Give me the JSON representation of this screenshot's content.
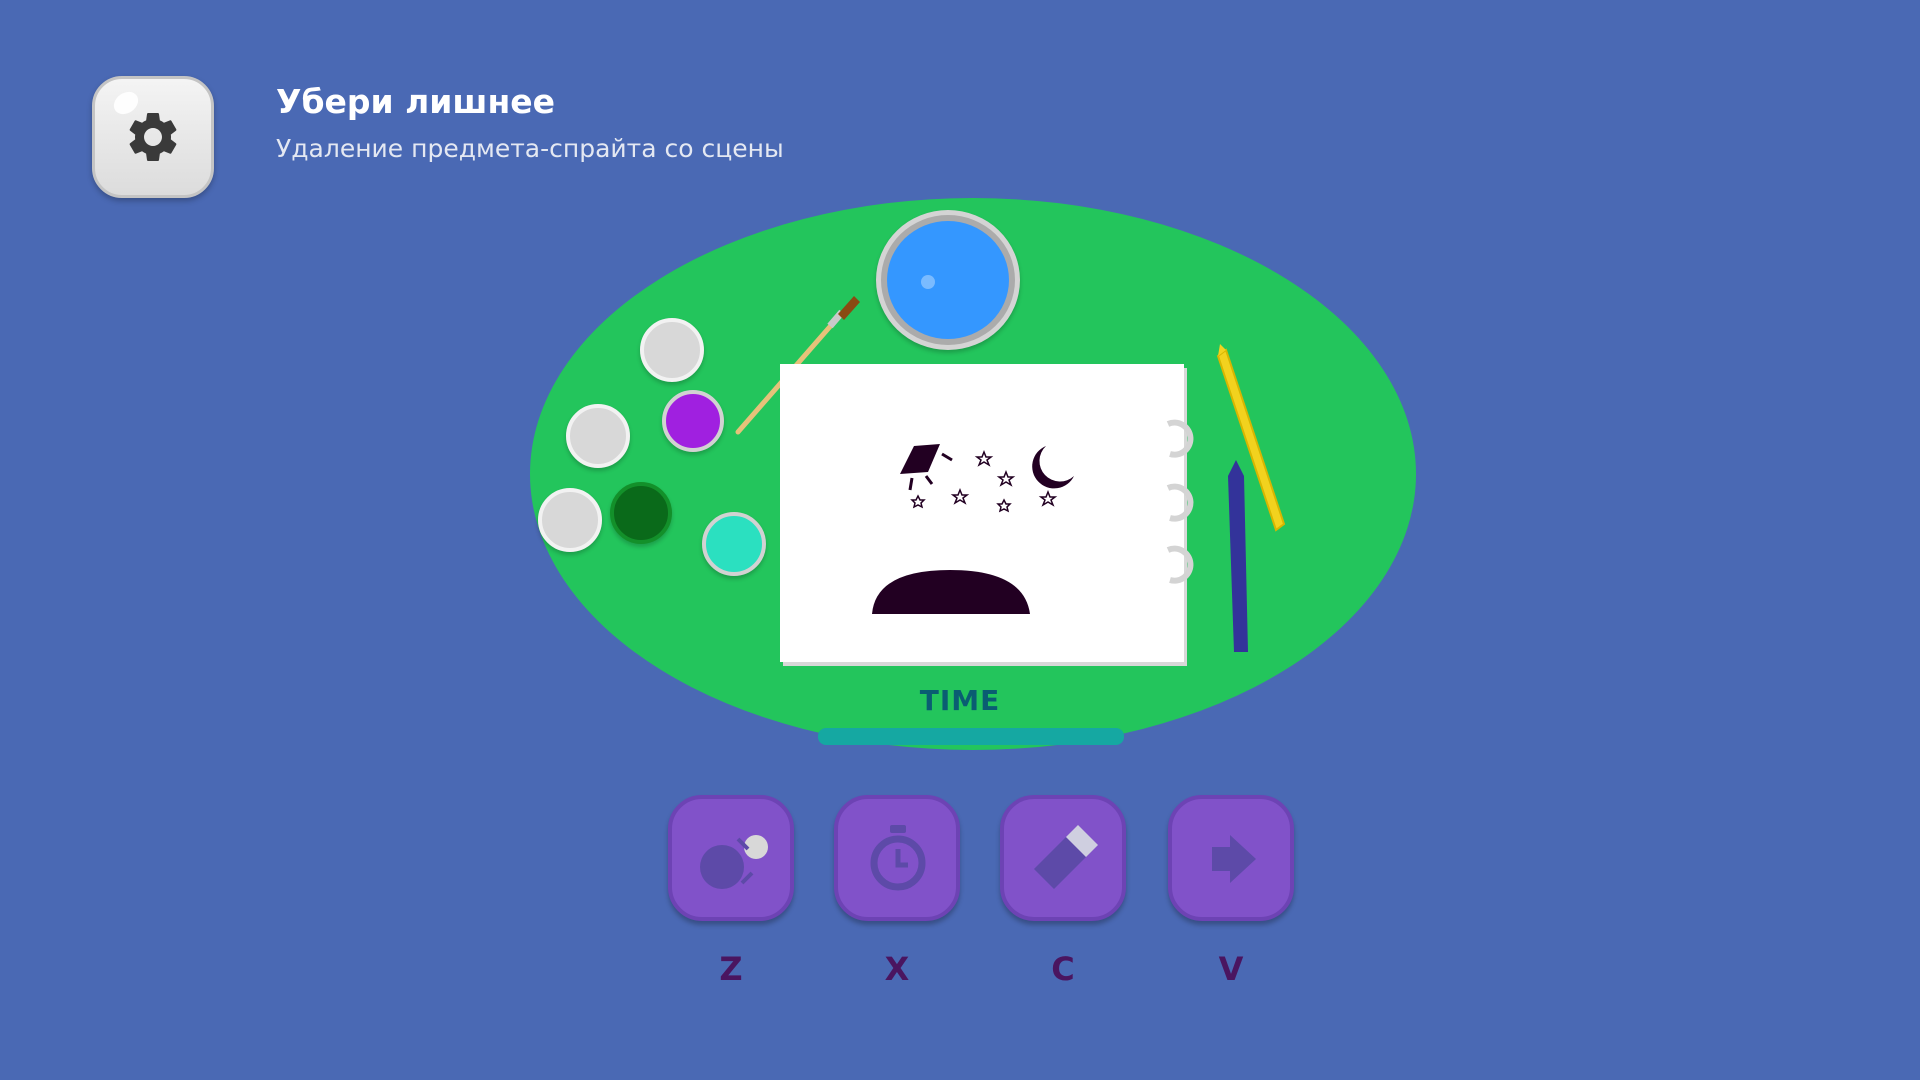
{
  "header": {
    "title": "Убери лишнее",
    "subtitle": "Удаление предмета-спрайта со сцены",
    "settings_icon": "gear-icon"
  },
  "scene": {
    "paint_colors": [
      "#d8d8d8",
      "#d8d8d8",
      "#d8d8d8",
      "#a020e0",
      "#0a6a1a",
      "#2be0c0"
    ],
    "water_color": "#3497ff",
    "table_color": "#23c55c"
  },
  "timer": {
    "label": "TIME"
  },
  "tools": [
    {
      "key": "Z",
      "icon": "bomb-icon"
    },
    {
      "key": "X",
      "icon": "stopwatch-icon"
    },
    {
      "key": "C",
      "icon": "eraser-icon"
    },
    {
      "key": "V",
      "icon": "arrow-right-icon"
    }
  ],
  "colors": {
    "background": "#4a69b4",
    "button": "#8152c9",
    "key_text": "#4a1560",
    "time_text": "#0a5d72"
  }
}
